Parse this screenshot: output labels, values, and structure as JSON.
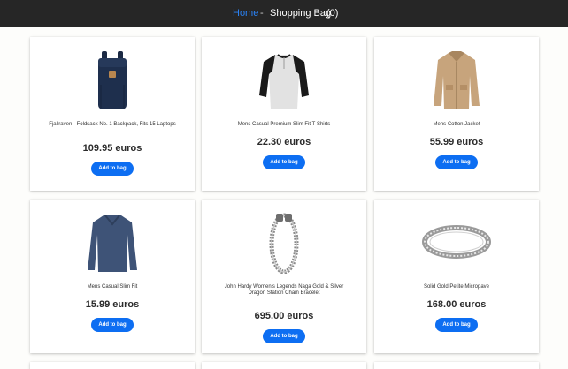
{
  "nav": {
    "home": "Home",
    "separator": "-",
    "bag_label": "Shopping Bag",
    "bag_count": "(0)"
  },
  "colors": {
    "topbar": "#262626",
    "link": "#2a82f5",
    "button": "#0d6ef2"
  },
  "products": [
    {
      "title": "Fjallraven - Foldsack No. 1 Backpack, Fits 15 Laptops",
      "price": "109.95 euros",
      "button": "Add to bag",
      "image": "backpack-image"
    },
    {
      "title": "Mens Casual Premium Slim Fit T-Shirts",
      "price": "22.30 euros",
      "button": "Add to bag",
      "image": "tshirt-image"
    },
    {
      "title": "Mens Cotton Jacket",
      "price": "55.99 euros",
      "button": "Add to bag",
      "image": "jacket-image"
    },
    {
      "title": "Mens Casual Slim Fit",
      "price": "15.99 euros",
      "button": "Add to bag",
      "image": "sweater-image"
    },
    {
      "title": "John Hardy Women's Legends Naga Gold & Silver Dragon Station Chain Bracelet",
      "price": "695.00 euros",
      "button": "Add to bag",
      "image": "bracelet-image"
    },
    {
      "title": "Solid Gold Petite Micropave",
      "price": "168.00 euros",
      "button": "Add to bag",
      "image": "ring-image"
    }
  ]
}
